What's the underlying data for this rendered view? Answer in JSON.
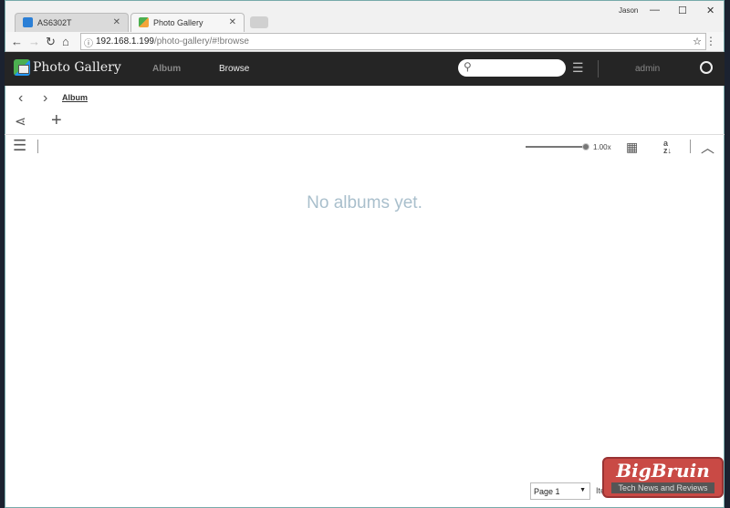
{
  "browser": {
    "tabs": [
      {
        "label": "AS6302T"
      },
      {
        "label": "Photo Gallery"
      }
    ],
    "user": "Jason",
    "url_host": "192.168.1.199",
    "url_path": "/photo-gallery/#!browse"
  },
  "app": {
    "title": "Photo Gallery",
    "nav": [
      {
        "label": "Album"
      },
      {
        "label": "Browse"
      }
    ],
    "search_placeholder": "",
    "user": "admin"
  },
  "breadcrumb": {
    "current": "Album"
  },
  "view": {
    "zoom_level": "1.00x",
    "zoom_fraction": 1.0
  },
  "main": {
    "empty_message": "No albums yet."
  },
  "footer": {
    "page_select": "Page 1",
    "items_label": "Ite"
  },
  "watermark": {
    "title": "BigBruin",
    "subtitle": "Tech News and Reviews"
  }
}
